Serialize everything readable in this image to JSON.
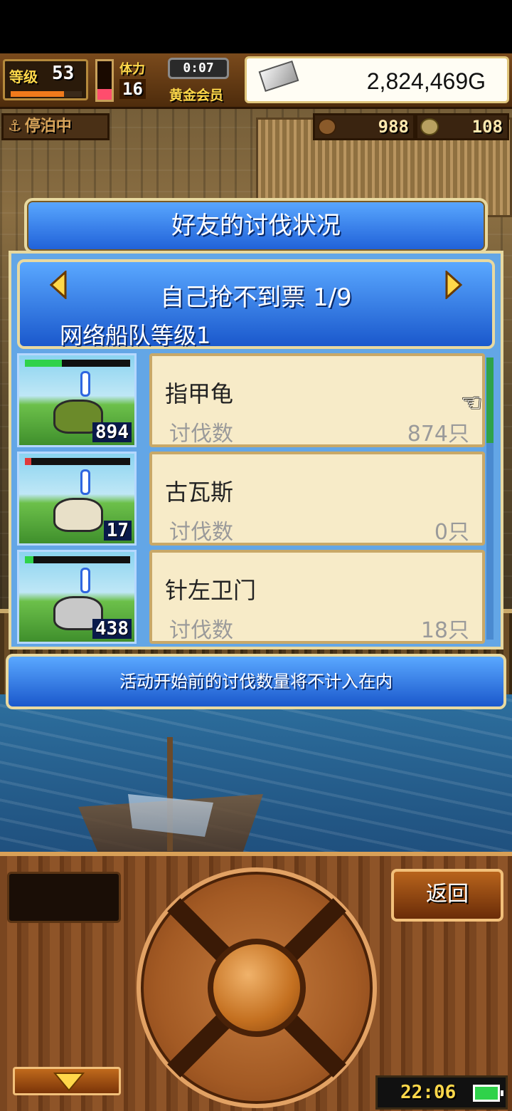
{
  "hud": {
    "level_label": "等级",
    "level_value": "53",
    "level_progress": 0.75,
    "stamina_label": "体力",
    "stamina_value": "16",
    "stamina_level": 0.28,
    "timer": "0:07",
    "membership": "黄金会员",
    "money": "2,824,469G",
    "status": "停泊中",
    "resource_1": "988",
    "resource_2": "108"
  },
  "dialog": {
    "title": "好友的讨伐状况",
    "header_title": "自己抢不到票 1/9",
    "header_sub": "网络船队等级1",
    "list": [
      {
        "name": "指甲龟",
        "label": "讨伐数",
        "count": "874只",
        "badge": "894",
        "hp_fraction": 0.35,
        "hp_color": "#2fd24a",
        "monster_color": "#6b8a2a"
      },
      {
        "name": "古瓦斯",
        "label": "讨伐数",
        "count": "0只",
        "badge": "17",
        "hp_fraction": 0.06,
        "hp_color": "#e03a3a",
        "monster_color": "#e8e0c8"
      },
      {
        "name": "针左卫门",
        "label": "讨伐数",
        "count": "18只",
        "badge": "438",
        "hp_fraction": 0.08,
        "hp_color": "#2fd24a",
        "monster_color": "#c8c8c8"
      }
    ],
    "notice": "活动开始前的讨伐数量将不计入在内"
  },
  "controls": {
    "back_label": "返回",
    "clock": "22:06"
  },
  "colors": {
    "dialog_blue": "#2f74e6",
    "frame_gold": "#e8d9a0",
    "card_bg": "#f7ebc8"
  }
}
